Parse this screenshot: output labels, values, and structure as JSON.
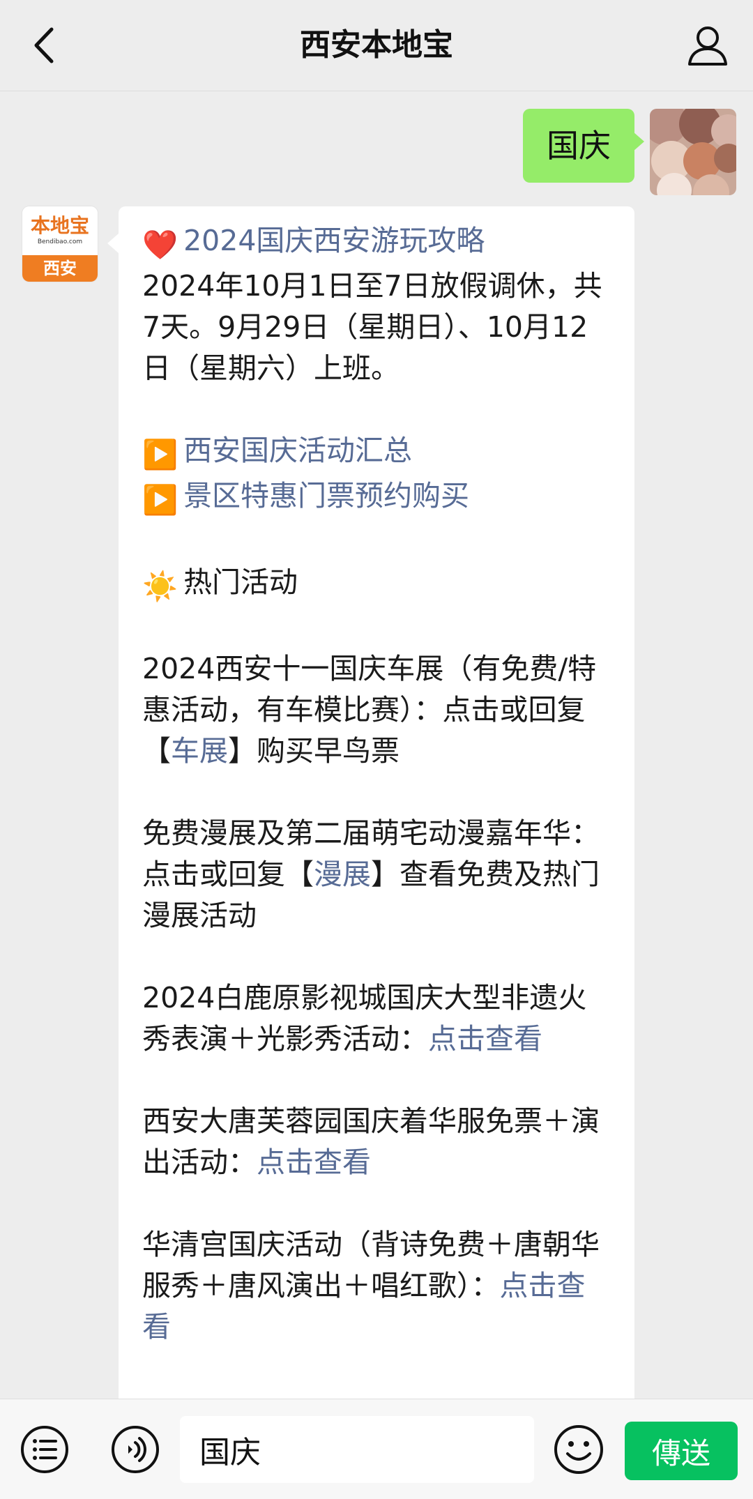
{
  "header": {
    "title": "西安本地宝"
  },
  "outgoing": {
    "text": "国庆"
  },
  "bot": {
    "logo_main": "本地宝",
    "logo_sub": "Bendibao.com",
    "logo_city": "西安"
  },
  "message": {
    "title_emoji": "❤️",
    "title": "2024国庆西安游玩攻略",
    "holiday_text": "2024年10月1日至7日放假调休，共7天。9月29日（星期日）、10月12日（星期六）上班。",
    "play_icon": "▶️",
    "link1": "西安国庆活动汇总",
    "link2": "景区特惠门票预约购买",
    "sun_icon": "☀️",
    "section": "热门活动",
    "item1_a": "2024西安十一国庆车展（有免费/特惠活动，有车模比赛）：点击或回复【",
    "item1_link": "车展",
    "item1_b": "】购买早鸟票",
    "item2_a": "免费漫展及第二届萌宅动漫嘉年华：点击或回复【",
    "item2_link": "漫展",
    "item2_b": "】查看免费及热门漫展活动",
    "item3_a": "2024白鹿原影视城国庆大型非遗火秀表演＋光影秀活动：",
    "item3_link": "点击查看",
    "item4_a": "西安大唐芙蓉园国庆着华服免票＋演出活动：",
    "item4_link": "点击查看",
    "item5_a": "华清宫国庆活动（背诗免费＋唐朝华服秀＋唐风演出＋唱红歌）：",
    "item5_link": "点击查看"
  },
  "input": {
    "value": "国庆",
    "send_label": "傳送"
  },
  "colors": {
    "link": "#576b95",
    "bubble_out": "#95ec69",
    "send": "#07c160",
    "logo_orange": "#ef7d22"
  },
  "icons": {
    "back": "chevron-left-icon",
    "profile": "person-icon",
    "menu": "list-menu-icon",
    "voice": "voice-icon",
    "emoji": "smiley-icon"
  }
}
